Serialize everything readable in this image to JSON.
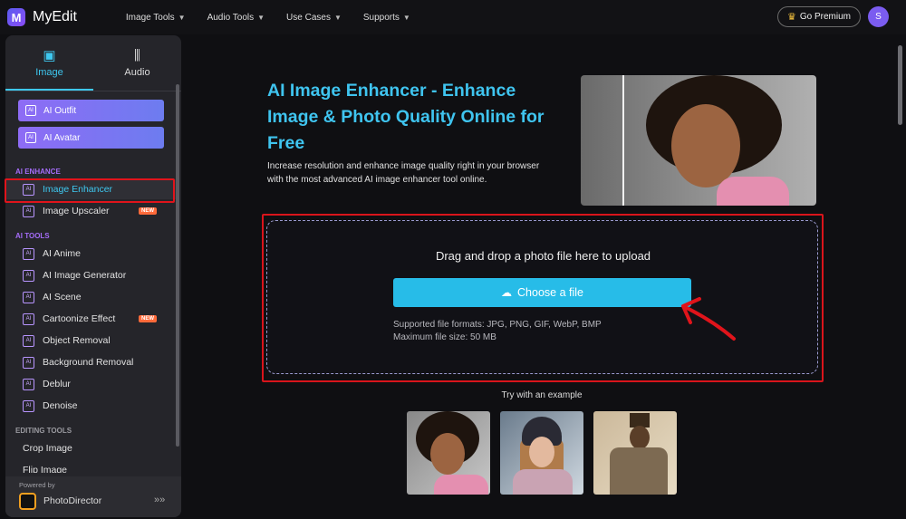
{
  "app": {
    "name": "MyEdit",
    "logo_letter": "M"
  },
  "nav": {
    "items": [
      {
        "label": "Image Tools"
      },
      {
        "label": "Audio Tools"
      },
      {
        "label": "Use Cases"
      },
      {
        "label": "Supports"
      }
    ],
    "premium_label": "Go Premium",
    "avatar_letter": "S"
  },
  "sidebar": {
    "tabs": [
      {
        "label": "Image",
        "icon": "image-icon",
        "active": true
      },
      {
        "label": "Audio",
        "icon": "waveform-icon",
        "active": false
      }
    ],
    "featured": [
      {
        "label": "AI Outfit"
      },
      {
        "label": "AI Avatar"
      }
    ],
    "sections": {
      "ai_enhance": "AI ENHANCE",
      "ai_tools": "AI TOOLS",
      "editing_tools": "EDITING TOOLS"
    },
    "enhance_items": [
      {
        "label": "Image Enhancer",
        "active": true
      },
      {
        "label": "Image Upscaler",
        "badge": "NEW"
      }
    ],
    "tool_items": [
      {
        "label": "AI Anime"
      },
      {
        "label": "AI Image Generator"
      },
      {
        "label": "AI Scene"
      },
      {
        "label": "Cartoonize Effect",
        "badge": "NEW"
      },
      {
        "label": "Object Removal"
      },
      {
        "label": "Background Removal"
      },
      {
        "label": "Deblur"
      },
      {
        "label": "Denoise"
      }
    ],
    "editing_items": [
      {
        "label": "Crop Image"
      },
      {
        "label": "Flip Image"
      }
    ],
    "powered_by": "Powered by",
    "powered_product": "PhotoDirector",
    "expand_glyph": "»»"
  },
  "hero": {
    "title": "AI Image Enhancer - Enhance Image & Photo Quality Online for Free",
    "description": "Increase resolution and enhance image quality right in your browser with the most advanced AI image enhancer tool online."
  },
  "upload": {
    "drop_text": "Drag and drop a photo file here to upload",
    "button_label": "Choose a file",
    "formats": "Supported file formats: JPG, PNG, GIF, WebP, BMP",
    "max_size": "Maximum file size: 50 MB"
  },
  "examples": {
    "label": "Try with an example"
  },
  "colors": {
    "accent": "#27bce8",
    "title": "#3fc4ef",
    "highlight": "#e0141b",
    "badge": "#ff6a3a"
  }
}
